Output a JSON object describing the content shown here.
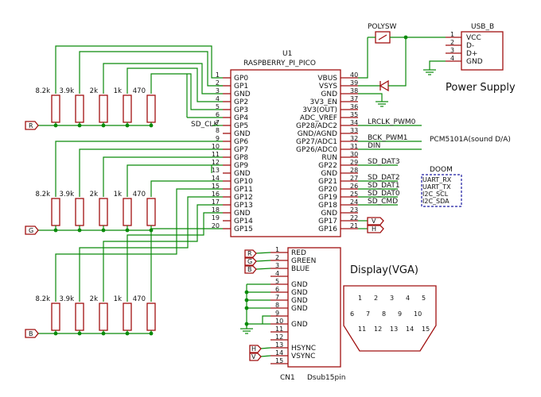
{
  "mcu": {
    "ref": "U1",
    "part": "RASPBERRY_PI_PICO",
    "left_pins": [
      {
        "num": "1",
        "name": "GP0"
      },
      {
        "num": "2",
        "name": "GP1"
      },
      {
        "num": "3",
        "name": "GND"
      },
      {
        "num": "4",
        "name": "GP2"
      },
      {
        "num": "5",
        "name": "GP3"
      },
      {
        "num": "6",
        "name": "GP4"
      },
      {
        "num": "7",
        "name": "GP5"
      },
      {
        "num": "8",
        "name": "GND"
      },
      {
        "num": "9",
        "name": "GP6"
      },
      {
        "num": "10",
        "name": "GP7"
      },
      {
        "num": "11",
        "name": "GP8"
      },
      {
        "num": "12",
        "name": "GP9"
      },
      {
        "num": "13",
        "name": "GND"
      },
      {
        "num": "14",
        "name": "GP10"
      },
      {
        "num": "15",
        "name": "GP11"
      },
      {
        "num": "16",
        "name": "GP12"
      },
      {
        "num": "17",
        "name": "GP13"
      },
      {
        "num": "18",
        "name": "GND"
      },
      {
        "num": "19",
        "name": "GP14"
      },
      {
        "num": "20",
        "name": "GP15"
      }
    ],
    "right_pins": [
      {
        "num": "40",
        "name": "VBUS"
      },
      {
        "num": "39",
        "name": "VSYS"
      },
      {
        "num": "38",
        "name": "GND"
      },
      {
        "num": "37",
        "name": "3V3_EN"
      },
      {
        "num": "36",
        "name": "3V3(OUT)"
      },
      {
        "num": "35",
        "name": "ADC_VREF"
      },
      {
        "num": "34",
        "name": "GP28/ADC2"
      },
      {
        "num": "33",
        "name": "GND/AGND"
      },
      {
        "num": "32",
        "name": "GP27/ADC1"
      },
      {
        "num": "31",
        "name": "GP26/ADC0"
      },
      {
        "num": "30",
        "name": "RUN"
      },
      {
        "num": "29",
        "name": "GP22"
      },
      {
        "num": "28",
        "name": "GND"
      },
      {
        "num": "27",
        "name": "GP21"
      },
      {
        "num": "26",
        "name": "GP20"
      },
      {
        "num": "25",
        "name": "GP19"
      },
      {
        "num": "24",
        "name": "GP18"
      },
      {
        "num": "23",
        "name": "GND"
      },
      {
        "num": "22",
        "name": "GP17"
      },
      {
        "num": "21",
        "name": "GP16"
      }
    ]
  },
  "nets": {
    "sd_clk": "SD_CLK",
    "lrclk": "LRCLK_PWM0",
    "bck": "BCK_PWM1",
    "din": "DIN",
    "sd_dat3": "SD_DAT3",
    "sd_dat2": "SD_DAT2",
    "sd_dat1": "SD_DAT1",
    "sd_dat0": "SD_DAT0",
    "sd_cmd": "SD_CMD",
    "dac_note": "PCM5101A(sound D/A)"
  },
  "doom": {
    "title": "DOOM",
    "lines": [
      "UART_RX",
      "UART_TX",
      "I2C_SCL",
      "I2C_SDA"
    ]
  },
  "resistors": [
    "8.2k",
    "3.9k",
    "2k",
    "1k",
    "470"
  ],
  "color_ports": {
    "r": "R",
    "g": "G",
    "b": "B"
  },
  "sync_ports": {
    "v": "V",
    "h": "H"
  },
  "power": {
    "polyfuse": "POLYSW",
    "usb": {
      "label": "USB_B",
      "pins": [
        {
          "num": "1",
          "name": "VCC"
        },
        {
          "num": "2",
          "name": "D-"
        },
        {
          "num": "3",
          "name": "D+"
        },
        {
          "num": "4",
          "name": "GND"
        }
      ]
    },
    "title": "Power Supply"
  },
  "connector": {
    "ref": "CN1",
    "part": "Dsub15pin",
    "pins": [
      {
        "num": "1",
        "name": "RED"
      },
      {
        "num": "2",
        "name": "GREEN"
      },
      {
        "num": "3",
        "name": "BLUE"
      },
      {
        "num": "4",
        "name": ""
      },
      {
        "num": "5",
        "name": "GND"
      },
      {
        "num": "6",
        "name": "GND"
      },
      {
        "num": "7",
        "name": "GND"
      },
      {
        "num": "8",
        "name": "GND"
      },
      {
        "num": "9",
        "name": ""
      },
      {
        "num": "10",
        "name": "GND"
      },
      {
        "num": "11",
        "name": ""
      },
      {
        "num": "12",
        "name": ""
      },
      {
        "num": "13",
        "name": "HSYNC"
      },
      {
        "num": "14",
        "name": "VSYNC"
      },
      {
        "num": "15",
        "name": ""
      }
    ]
  },
  "display": {
    "title": "Display(VGA)",
    "row1": [
      "1",
      "2",
      "3",
      "4",
      "5"
    ],
    "row2": [
      "6",
      "7",
      "8",
      "9",
      "10"
    ],
    "row3": [
      "11",
      "12",
      "13",
      "14",
      "15"
    ]
  }
}
